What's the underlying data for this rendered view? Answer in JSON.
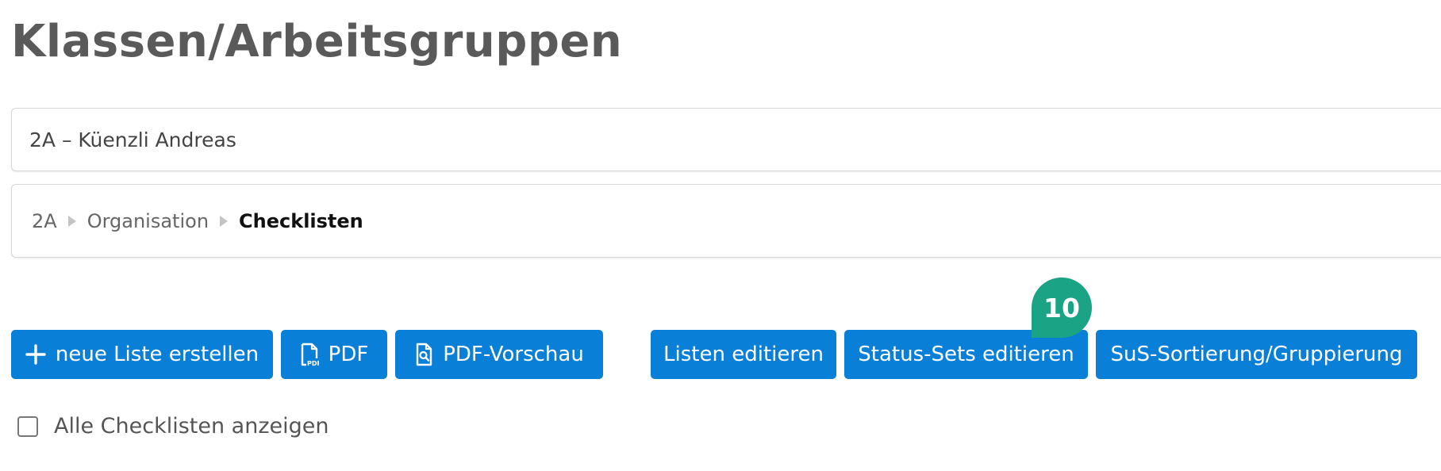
{
  "header": {
    "title": "Klassen/Arbeitsgruppen"
  },
  "class_selector": {
    "value": "2A – Küenzli Andreas"
  },
  "breadcrumb": {
    "items": [
      "2A",
      "Organisation",
      "Checklisten"
    ]
  },
  "toolbar": {
    "new_list_label": "neue Liste erstellen",
    "pdf_label": "PDF",
    "pdf_preview_label": "PDF-Vorschau",
    "edit_lists_label": "Listen editieren",
    "edit_status_sets_label": "Status-Sets editieren",
    "sorting_label": "SuS-Sortierung/Gruppierung",
    "icons": {
      "new_list": "plus-icon",
      "pdf": "pdf-file-icon",
      "pdf_preview": "file-search-icon"
    }
  },
  "step_badge": {
    "number": "10",
    "color": "#1aa385"
  },
  "options": {
    "show_all_label": "Alle Checklisten anzeigen",
    "show_all_checked": false
  },
  "colors": {
    "primary_button": "#0a7fd8",
    "badge": "#1aa385",
    "title": "#5a5a5a"
  }
}
